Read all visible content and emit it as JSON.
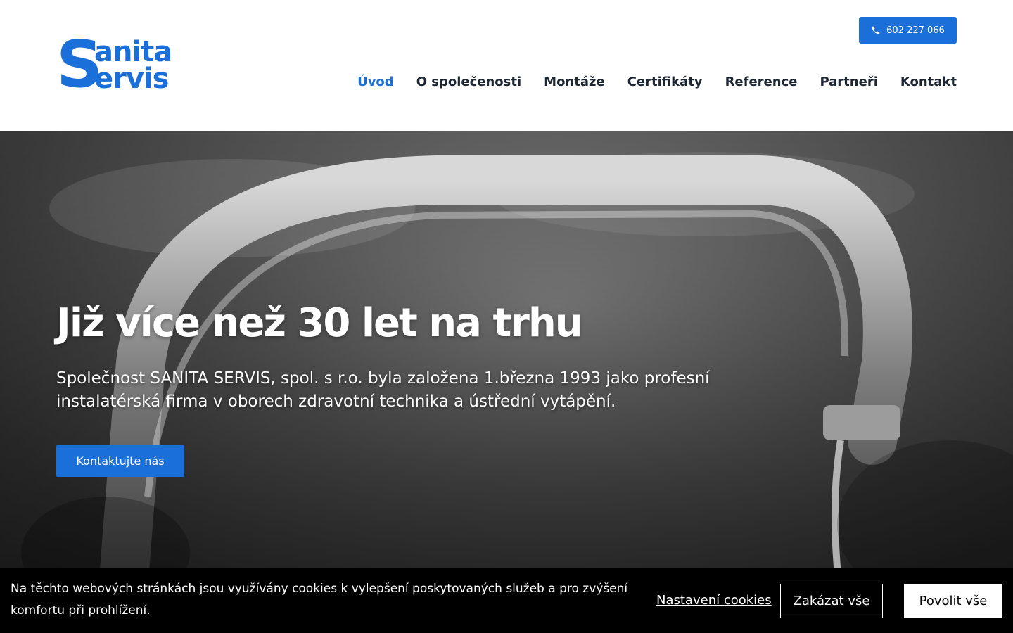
{
  "brand": {
    "logo_s": "S",
    "logo_line1": "anita",
    "logo_line2": "ervis",
    "color": "#1a6fd9"
  },
  "header": {
    "phone_icon": "phone-icon",
    "phone": "602 227 066"
  },
  "nav": {
    "items": [
      {
        "label": "Úvod",
        "active": true
      },
      {
        "label": "O společenosti"
      },
      {
        "label": "Montáže"
      },
      {
        "label": "Certifikáty"
      },
      {
        "label": "Reference"
      },
      {
        "label": "Partneři"
      },
      {
        "label": "Kontakt"
      }
    ]
  },
  "hero": {
    "title": "Již více než 30 let na trhu",
    "text": "Společnost SANITA SERVIS, spol. s r.o. byla založena 1.března 1993 jako profesní instalatérská firma v oborech zdravotní technika a ústřední vytápění.",
    "button": "Kontaktujte nás"
  },
  "cookies": {
    "text": "Na těchto webových stránkách jsou využívány cookies k vylepšení poskytovaných služeb a pro zvýšení komfortu při prohlížení.",
    "settings": "Nastavení cookies",
    "deny": "Zakázat vše",
    "allow": "Povolit vše"
  }
}
